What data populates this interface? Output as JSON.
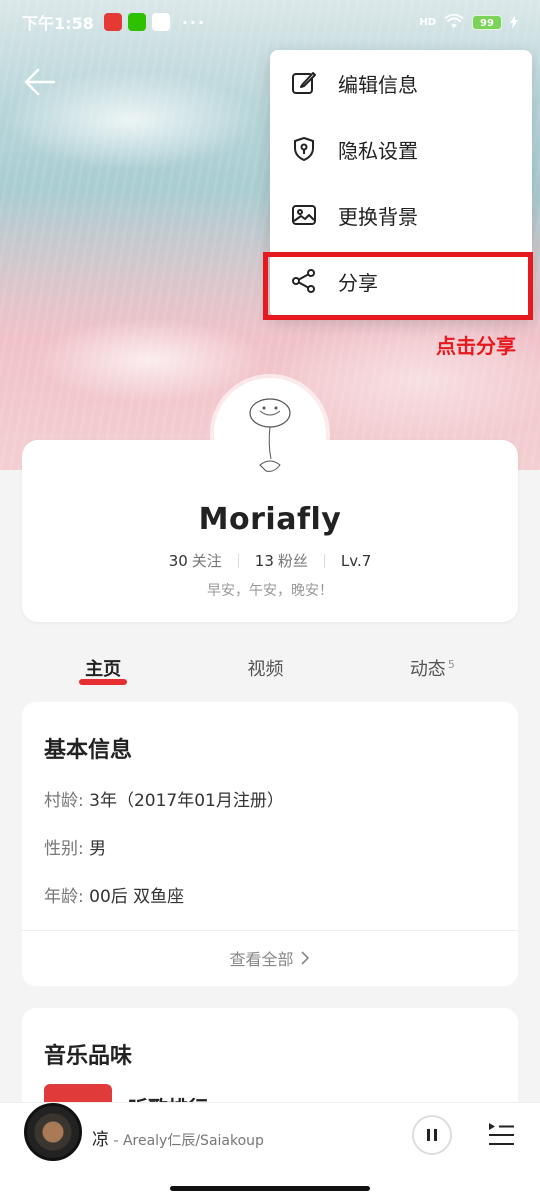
{
  "status_bar": {
    "time": "下午1:58",
    "dots": "···",
    "network": "HD",
    "battery": "99"
  },
  "menu": {
    "items": [
      {
        "label": "编辑信息",
        "icon": "edit-icon"
      },
      {
        "label": "隐私设置",
        "icon": "shield-icon"
      },
      {
        "label": "更换背景",
        "icon": "image-icon"
      },
      {
        "label": "分享",
        "icon": "share-icon"
      }
    ]
  },
  "annotation": {
    "text": "点击分享",
    "color": "#e6191e"
  },
  "profile": {
    "name": "Moriafly",
    "follows_count": "30",
    "follows_label": "关注",
    "fans_count": "13",
    "fans_label": "粉丝",
    "level": "Lv.7",
    "signature": "早安，午安，晚安！"
  },
  "tabs": [
    {
      "label": "主页",
      "active": true
    },
    {
      "label": "视频",
      "active": false
    },
    {
      "label": "动态",
      "badge": "5",
      "active": false
    }
  ],
  "basic_info": {
    "title": "基本信息",
    "rows": [
      {
        "key": "村龄:",
        "value": "3年（2017年01月注册）"
      },
      {
        "key": "性别:",
        "value": "男"
      },
      {
        "key": "年龄:",
        "value": "00后 双鱼座"
      }
    ],
    "see_all": "查看全部"
  },
  "music_taste": {
    "title": "音乐品味",
    "item_label": "听歌排行"
  },
  "player": {
    "song": "凉",
    "separator": " - ",
    "artist": "Arealy仁辰/Saiakoup"
  },
  "colors": {
    "accent": "#e6191e",
    "battery": "#7bd35a"
  }
}
